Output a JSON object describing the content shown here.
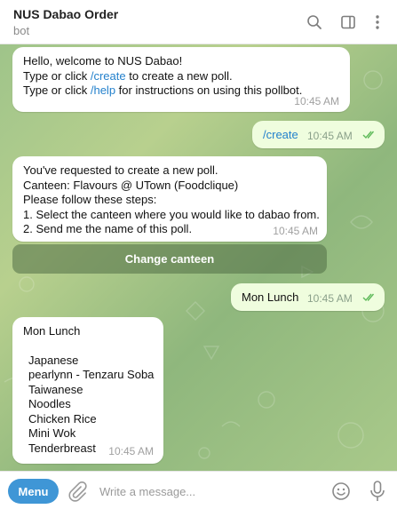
{
  "header": {
    "title": "NUS Dabao Order",
    "subtitle": "bot",
    "icons": [
      "search-icon",
      "sidebar-toggle-icon",
      "more-vertical-icon"
    ]
  },
  "messages": {
    "welcome": {
      "greeting": "Hello, welcome to NUS Dabao!",
      "line2_prefix": "Type or click ",
      "line2_cmd": "/create",
      "line2_suffix": " to create a new poll.",
      "line3_prefix": "Type or click ",
      "line3_cmd": "/help",
      "line3_suffix": " for instructions on using this pollbot.",
      "time": "10:45 AM"
    },
    "cmd_create": {
      "text": "/create",
      "time": "10:45 AM"
    },
    "create_reply": {
      "lines": [
        "You've requested to create a new poll.",
        "Canteen: Flavours @ UTown (Foodclique)",
        "Please follow these steps:",
        "1. Select the canteen where you would like to dabao from.",
        "2. Send me the name of this poll."
      ],
      "time": "10:45 AM",
      "keyboard_button": "Change canteen"
    },
    "poll_name": {
      "text": "Mon Lunch",
      "time": "10:45 AM"
    },
    "poll": {
      "title": "Mon Lunch",
      "options": [
        "Japanese",
        "pearlynn - Tenzaru Soba",
        "Taiwanese",
        "Noodles",
        "Chicken Rice",
        "Mini Wok",
        "Tenderbreast"
      ],
      "time": "10:45 AM"
    }
  },
  "composer": {
    "menu_label": "Menu",
    "placeholder": "Write a message..."
  },
  "colors": {
    "accent": "#3f96d6",
    "link": "#2481cc",
    "outgoing_bubble": "#effdde",
    "read_ticks": "#5fba5a"
  }
}
